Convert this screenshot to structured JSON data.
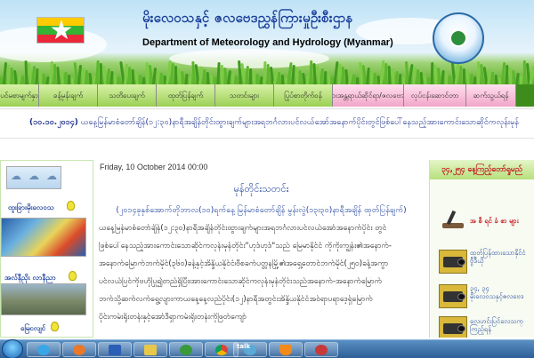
{
  "header": {
    "title_mm": "မိုးလေဝသနှင့် ဇလဗေဒညွှန်ကြားမှုဦးစီးဌာန",
    "title_en": "Department of Meteorology and Hydrology (Myanmar)"
  },
  "nav": {
    "items": [
      {
        "label": "ပင်မစာမျက်နှာ",
        "w": 44,
        "tone": "green"
      },
      {
        "label": "ခန့်မှန်းချက်",
        "w": 66,
        "tone": "green"
      },
      {
        "label": "သတိပေးချက်",
        "w": 66,
        "tone": "green"
      },
      {
        "label": "ထုတ်ပြန်ချက်",
        "w": 66,
        "tone": "green"
      },
      {
        "label": "သတင်းများ",
        "w": 66,
        "tone": "green"
      },
      {
        "label": "ပြုပ်စာတိုက်ဝန်",
        "w": 66,
        "tone": "green"
      },
      {
        "label": "သဘာဝ ဘေးအန္တရာယ်ဆိုင်ရာ/ဇလဗေဒ အကြောင်း",
        "w": 80,
        "tone": "pink"
      },
      {
        "label": "လုပ်ငန်းဆောင်တာ",
        "w": 70,
        "tone": "pink"
      },
      {
        "label": "ဆက်သွယ်ရန်",
        "w": 56,
        "tone": "pink"
      }
    ]
  },
  "ticker": {
    "date": "(၁၀.၁၀.၂၀၁၄)",
    "text": " ယနေ့မြန်မာစံတော်ချိန်(၁၂:၃၀)နာရီအချိန်တိုင်းထွားချက်များအရဘင်္ဂလားပင်လယ်အော်အနောက်ပိုင်းတွင်ဖြစ်ပေါ်နေသည့်အားကောင်းသောဆိုင်ကလုန်းမုန်"
  },
  "left": {
    "cap_warning": "ထူးခြားမိုးလေဝသ",
    "cap_storm": "အလ်နီညိုး လာနီညာ",
    "cap_flood": "မြေငလျင်"
  },
  "main": {
    "date": "Friday, 10 October 2014 00:00",
    "title": "မုန်တိုင်းသတင်း",
    "subtitle": "(၂၀၁၄ခုနှစ်အောက်တိုဘာလ(၁၀)ရက်နေ့ မြန်မာစံတော်ချိန် မွန်းလွဲ(၁၃း၃၀)နာရီအချိန် ထုတ်ပြန်ချက်)",
    "lines": [
      "ယနေ့မြန်မာစံတော်ချိန်(၁၂:၃၀)နာရီအချိန်တိုင်းထွားချက်များအရဘင်္ဂလားပင်လယ်အော်အနောက်ပိုင်း တွင်",
      "ဖြစ်ပေါ်နေသည့်အားကောင်းသောဆိုင်ကလုန်းမုန်တိုင်း\"ဟုဒ်ဟုဒ်\"သည် မြေမာနိုင်ငံ ကိုကိုးကျွန်း၏အနောက်-",
      "အနောက်မြောက်ဘက်မိုင်(၃၆၀)ခန့်နှင့်အိန္ဒိယနိုင်ငံ၊ဗီစခက်ပတ္တနမြို့၏အရှေ့တောင်ဘက်မိုင်(၂၅၀)ခန့်အကွာ",
      "ပင်လယ်ပြင်ကိုဗဟိုပြု၍တည်ရှိပြီး၊အားကောင်းသောဆိုင်ကလုန်းမုန်တိုင်းသည်အနောက်-အနောက်မြောက်",
      "ဘက်သို့ဆက်လက်ရွေ့လျားကာယနေ့နေ့လည်ပိုင်း(၁၂)နာရီအတွင်းအိန္ဒိယနိုင်ငံအဝ်ရာပရာဒေ့ရှ်မြောက်",
      "ပိုင်းကမ်းရိုးတန်းနှင့်အော်ဒီရှာကမ်းရိုးတန်းကိုဖြတ်ကျော်"
    ]
  },
  "right": {
    "head": "၃၄,၂၅၄ နေ့ကြည့်တော်ရှုမည်",
    "items": [
      {
        "label": "အ စီ ရင် ခံ စာ များ"
      },
      {
        "label": "ထုတ်ပြန်ထားသောနိုင်ငံ\nဗွီဒီယို"
      },
      {
        "label": "၃၄, ၃၄\nမိုးလေဝသနှင့်ဇလဗေဒ"
      },
      {
        "label": "လေဟင်းပြင်လေသက္\nကြည့်ရန်"
      }
    ]
  },
  "taskbar": {
    "talk_label": "talk"
  },
  "colors": {
    "title_blue": "#1b3f9a",
    "nav_green": "#9bd055",
    "nav_pink": "#f2a6c8",
    "alert_red": "#c4121b"
  }
}
